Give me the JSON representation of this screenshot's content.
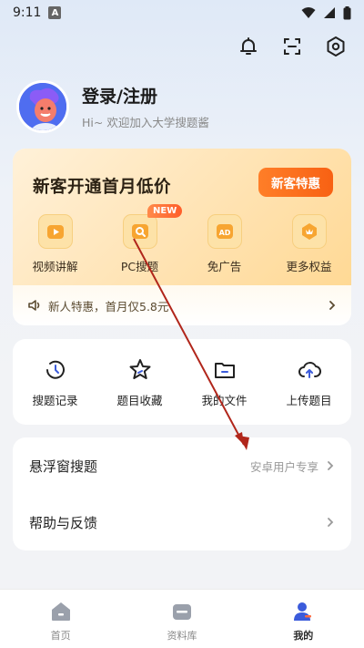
{
  "status_bar": {
    "time": "9:11",
    "notif_letter": "A"
  },
  "profile": {
    "name": "登录/注册",
    "subtitle": "Hi~ 欢迎加入大学搜题酱"
  },
  "vip": {
    "title": "新客开通首月低价",
    "button": "新客特惠",
    "new_tag": "NEW",
    "items": [
      {
        "label": "视频讲解",
        "icon": "play-icon"
      },
      {
        "label": "PC搜题",
        "icon": "search-icon"
      },
      {
        "label": "免广告",
        "icon": "ad-icon"
      },
      {
        "label": "更多权益",
        "icon": "crown-icon"
      }
    ],
    "promo": "新人特惠，首月仅5.8元"
  },
  "tools": [
    {
      "label": "搜题记录",
      "icon": "history-icon"
    },
    {
      "label": "题目收藏",
      "icon": "star-icon"
    },
    {
      "label": "我的文件",
      "icon": "folder-icon"
    },
    {
      "label": "上传题目",
      "icon": "cloud-upload-icon"
    }
  ],
  "menu": [
    {
      "title": "悬浮窗搜题",
      "hint": "安卓用户专享"
    },
    {
      "title": "帮助与反馈",
      "hint": ""
    }
  ],
  "tabs": [
    {
      "label": "首页",
      "icon": "home-icon",
      "active": false
    },
    {
      "label": "资料库",
      "icon": "library-icon",
      "active": false
    },
    {
      "label": "我的",
      "icon": "user-icon",
      "active": true
    }
  ],
  "colors": {
    "accent": "#3b5bdb",
    "vip_button": "#f86113",
    "annotation_arrow": "#b1261b"
  }
}
